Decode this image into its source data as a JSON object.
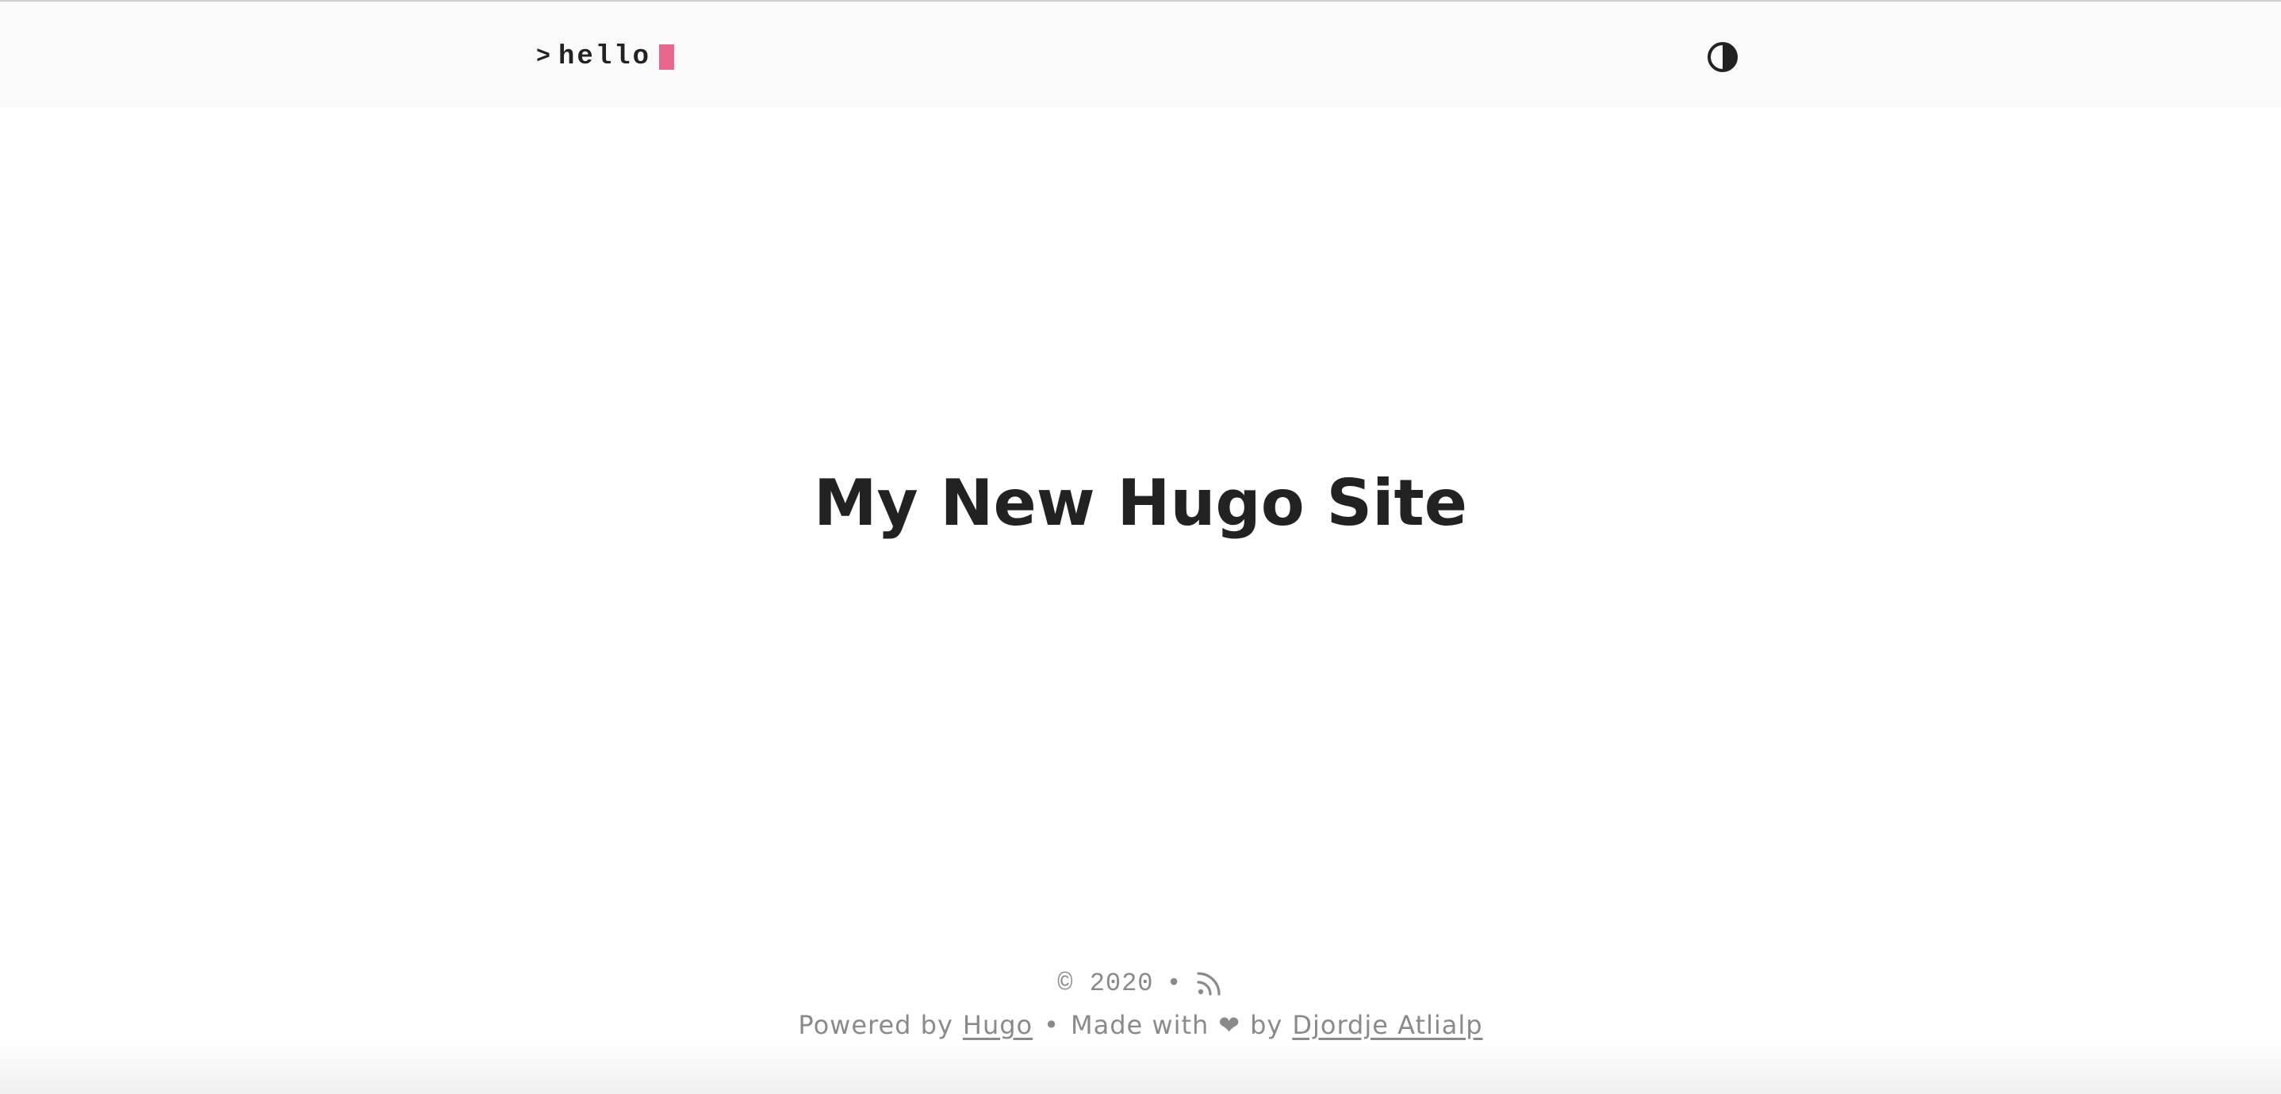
{
  "header": {
    "logo_prompt": ">",
    "logo_text": "hello",
    "cursor_color": "#e9668b",
    "theme_toggle_icon": "half-circle-contrast-icon"
  },
  "main": {
    "title": "My New Hugo Site"
  },
  "footer": {
    "copyright": "© 2020",
    "separator": "•",
    "rss_icon": "rss-icon",
    "powered_by_label": "Powered by",
    "hugo_link": "Hugo",
    "made_with_label": "Made with",
    "heart": "❤",
    "by_label": "by",
    "author_link": "Djordje Atlialp"
  }
}
